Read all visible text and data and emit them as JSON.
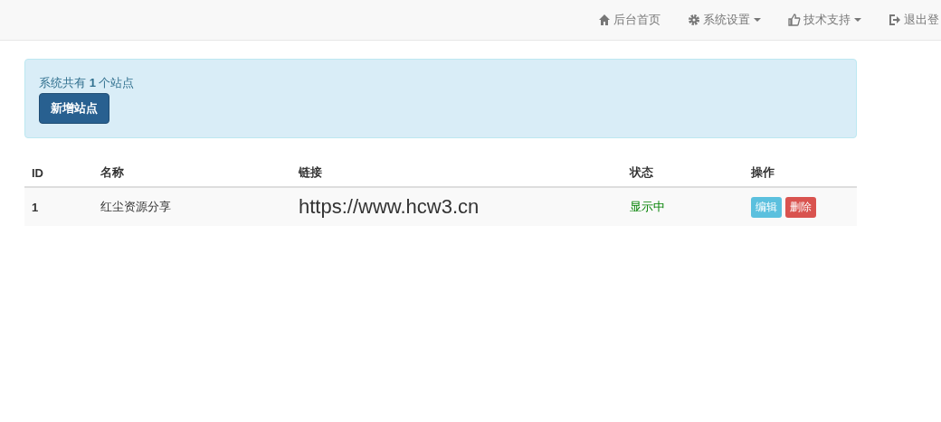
{
  "navbar": {
    "items": [
      {
        "label": "后台首页",
        "dropdown": false
      },
      {
        "label": "系统设置",
        "dropdown": true
      },
      {
        "label": "技术支持",
        "dropdown": true
      },
      {
        "label": "退出登",
        "dropdown": false
      }
    ]
  },
  "alert": {
    "text": "系统共有 **1** 个站点",
    "button": "新增站点"
  },
  "table": {
    "columns": [
      "ID",
      "名称",
      "链接",
      "状态",
      "操作"
    ],
    "rows": [
      {
        "id": "1",
        "name": "红尘资源分享",
        "link": "https://www.hcw3.cn",
        "status": "显示中",
        "actions": [
          {
            "label": "编辑",
            "kind": "info"
          },
          {
            "label": "删除",
            "kind": "danger"
          }
        ]
      }
    ]
  }
}
